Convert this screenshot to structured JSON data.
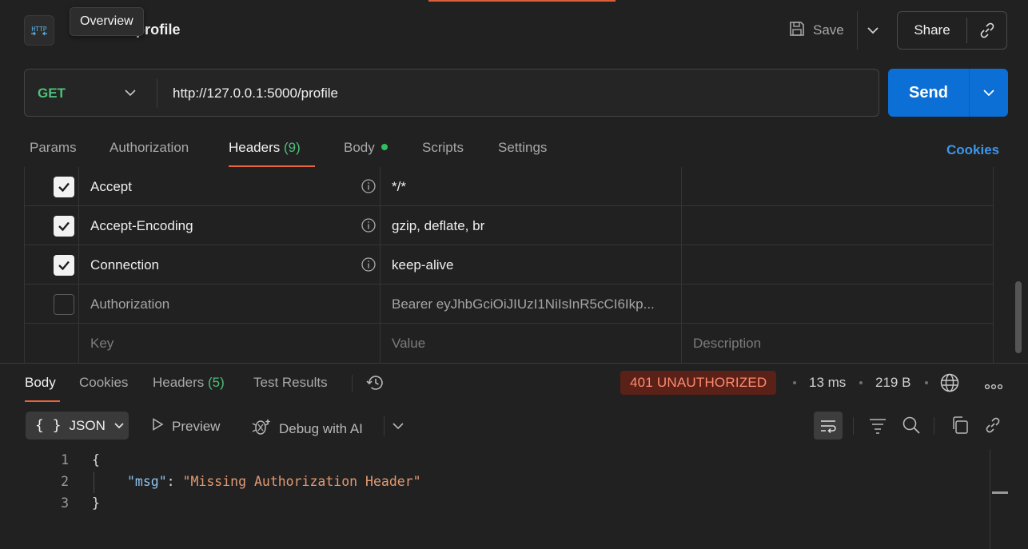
{
  "window": {
    "tooltip": "Overview",
    "request_title": "0.1:5000/profile",
    "http_badge": "HTTP"
  },
  "toolbar": {
    "save_label": "Save",
    "share_label": "Share"
  },
  "request": {
    "method": "GET",
    "url": "http://127.0.0.1:5000/profile",
    "send_label": "Send",
    "method_color": "#4fbf7a"
  },
  "request_tabs": [
    {
      "label": "Params"
    },
    {
      "label": "Authorization"
    },
    {
      "label": "Headers",
      "count": "(9)",
      "active": true
    },
    {
      "label": "Body"
    },
    {
      "label": "Scripts"
    },
    {
      "label": "Settings"
    }
  ],
  "cookies_link": "Cookies",
  "headers_table": {
    "rows": [
      {
        "checked": true,
        "key": "Accept",
        "value": "*/*"
      },
      {
        "checked": true,
        "key": "Accept-Encoding",
        "value": "gzip, deflate, br"
      },
      {
        "checked": true,
        "key": "Connection",
        "value": "keep-alive"
      },
      {
        "checked": false,
        "key": "Authorization",
        "value": "Bearer eyJhbGciOiJIUzI1NiIsInR5cCI6Ikp..."
      }
    ],
    "placeholder": {
      "key": "Key",
      "value": "Value",
      "description": "Description"
    }
  },
  "response_tabs": [
    {
      "label": "Body",
      "active": true
    },
    {
      "label": "Cookies"
    },
    {
      "label": "Headers",
      "count": "(5)"
    },
    {
      "label": "Test Results"
    }
  ],
  "response_meta": {
    "status": "401 UNAUTHORIZED",
    "time": "13 ms",
    "size": "219 B",
    "status_color": "#ff8a70"
  },
  "response_toolbar": {
    "format": "JSON",
    "preview": "Preview",
    "debug": "Debug with AI"
  },
  "response_body": {
    "lines": [
      {
        "num": "1",
        "open": "{"
      },
      {
        "num": "2",
        "key": "\"msg\"",
        "sep": ": ",
        "value": "\"Missing Authorization Header\""
      },
      {
        "num": "3",
        "close": "}"
      }
    ]
  },
  "icons": [
    "http-icon",
    "save-icon",
    "chevron-down-icon",
    "link-icon",
    "info-icon",
    "history-icon",
    "globe-icon",
    "more-icon",
    "braces-icon",
    "play-icon",
    "debug-ai-icon",
    "wrap-icon",
    "filter-icon",
    "search-icon",
    "copy-icon",
    "check-icon"
  ]
}
